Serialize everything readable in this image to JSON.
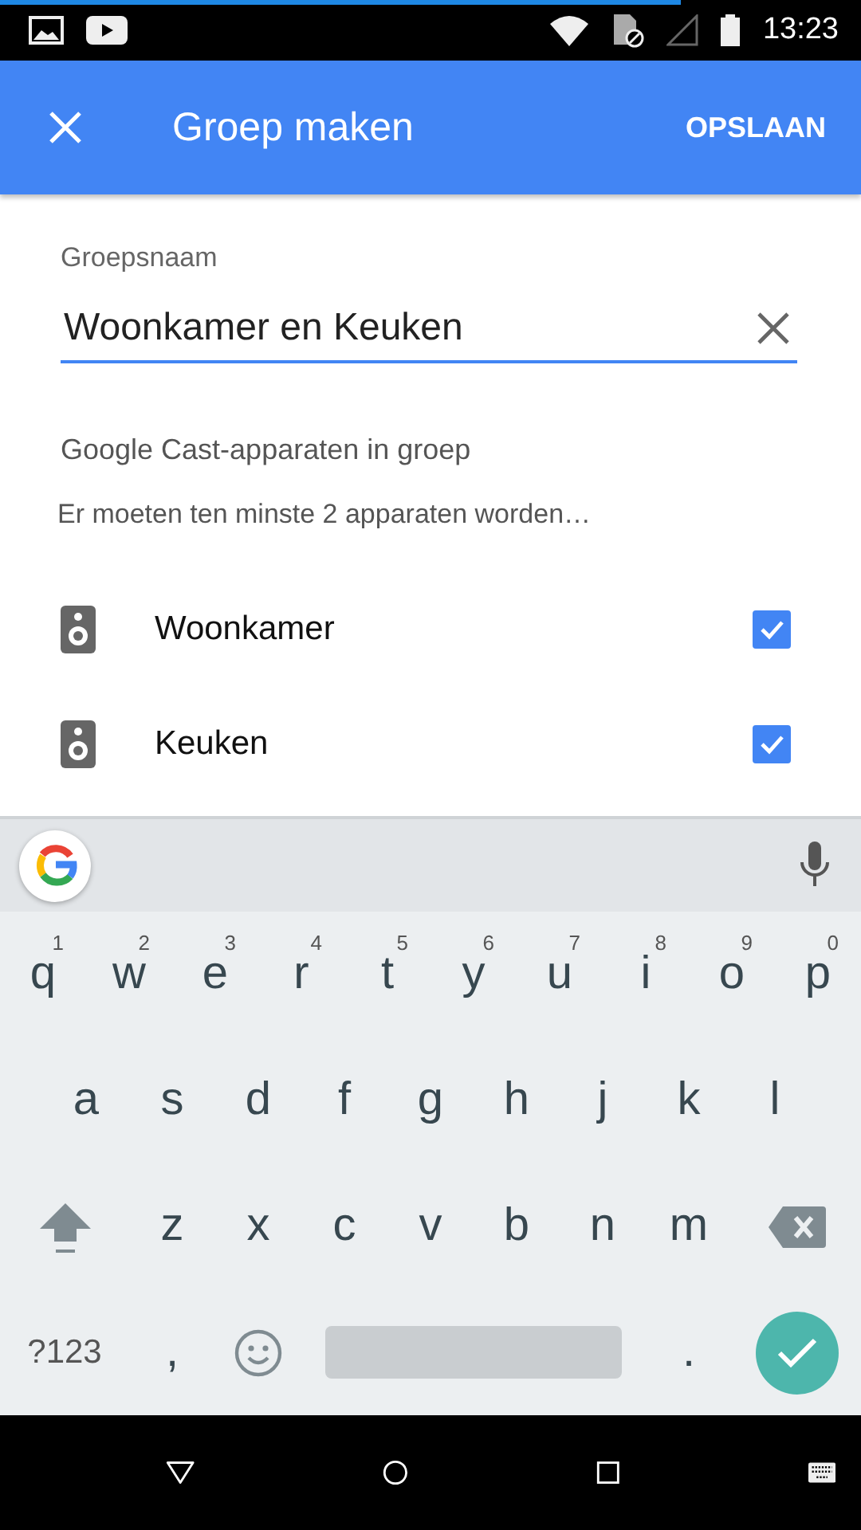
{
  "status_bar": {
    "time": "13:23",
    "progress": {
      "level": 0.79
    }
  },
  "app_bar": {
    "title": "Groep maken",
    "action": "OPSLAAN"
  },
  "name_field": {
    "label": "Groepsnaam",
    "value": "Woonkamer en Keuken"
  },
  "devices_section": {
    "heading": "Google Cast-apparaten in groep",
    "note": "Er moeten ten minste 2 apparaten worden…"
  },
  "devices": [
    {
      "name": "Woonkamer",
      "checked": true
    },
    {
      "name": "Keuken",
      "checked": true
    }
  ],
  "keyboard": {
    "rows": [
      {
        "keys": [
          {
            "kind": "char",
            "label": "q",
            "hint": "1"
          },
          {
            "kind": "char",
            "label": "w",
            "hint": "2"
          },
          {
            "kind": "char",
            "label": "e",
            "hint": "3"
          },
          {
            "kind": "char",
            "label": "r",
            "hint": "4"
          },
          {
            "kind": "char",
            "label": "t",
            "hint": "5"
          },
          {
            "kind": "char",
            "label": "y",
            "hint": "6"
          },
          {
            "kind": "char",
            "label": "u",
            "hint": "7"
          },
          {
            "kind": "char",
            "label": "i",
            "hint": "8"
          },
          {
            "kind": "char",
            "label": "o",
            "hint": "9"
          },
          {
            "kind": "char",
            "label": "p",
            "hint": "0"
          }
        ]
      },
      {
        "keys": [
          {
            "kind": "char",
            "label": "a"
          },
          {
            "kind": "char",
            "label": "s"
          },
          {
            "kind": "char",
            "label": "d"
          },
          {
            "kind": "char",
            "label": "f"
          },
          {
            "kind": "char",
            "label": "g"
          },
          {
            "kind": "char",
            "label": "h"
          },
          {
            "kind": "char",
            "label": "j"
          },
          {
            "kind": "char",
            "label": "k"
          },
          {
            "kind": "char",
            "label": "l"
          }
        ]
      },
      {
        "keys": [
          {
            "kind": "shift"
          },
          {
            "kind": "char",
            "label": "z"
          },
          {
            "kind": "char",
            "label": "x"
          },
          {
            "kind": "char",
            "label": "c"
          },
          {
            "kind": "char",
            "label": "v"
          },
          {
            "kind": "char",
            "label": "b"
          },
          {
            "kind": "char",
            "label": "n"
          },
          {
            "kind": "char",
            "label": "m"
          },
          {
            "kind": "backspace"
          }
        ]
      },
      {
        "keys": [
          {
            "kind": "symbols",
            "label": "?123"
          },
          {
            "kind": "char",
            "label": ","
          },
          {
            "kind": "emoji"
          },
          {
            "kind": "space"
          },
          {
            "kind": "char",
            "label": "."
          },
          {
            "kind": "enter"
          }
        ]
      }
    ]
  }
}
